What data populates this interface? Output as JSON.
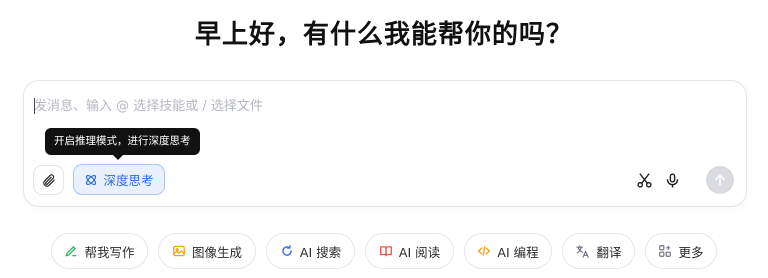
{
  "greeting": "早上好，有什么我能帮你的吗？",
  "composer": {
    "placeholder": "发消息、输入 @ 选择技能或 / 选择文件",
    "tooltip": "开启推理模式，进行深度思考",
    "deep_think_label": "深度思考"
  },
  "chips": [
    {
      "label": "帮我写作",
      "icon": "pen-icon",
      "color": "#34b36a"
    },
    {
      "label": "图像生成",
      "icon": "image-icon",
      "color": "#f0a31c"
    },
    {
      "label": "AI 搜索",
      "icon": "search-refresh-icon",
      "color": "#3a6ee8"
    },
    {
      "label": "AI 阅读",
      "icon": "book-icon",
      "color": "#e5544b"
    },
    {
      "label": "AI 编程",
      "icon": "code-icon",
      "color": "#f0a31c"
    },
    {
      "label": "翻译",
      "icon": "translate-icon",
      "color": "#6b7280"
    },
    {
      "label": "更多",
      "icon": "grid-icon",
      "color": "#6b7280"
    }
  ],
  "colors": {
    "accent": "#2f6be0",
    "deep_think_bg": "#e9f1ff",
    "send_disabled": "#d9dbe0"
  }
}
